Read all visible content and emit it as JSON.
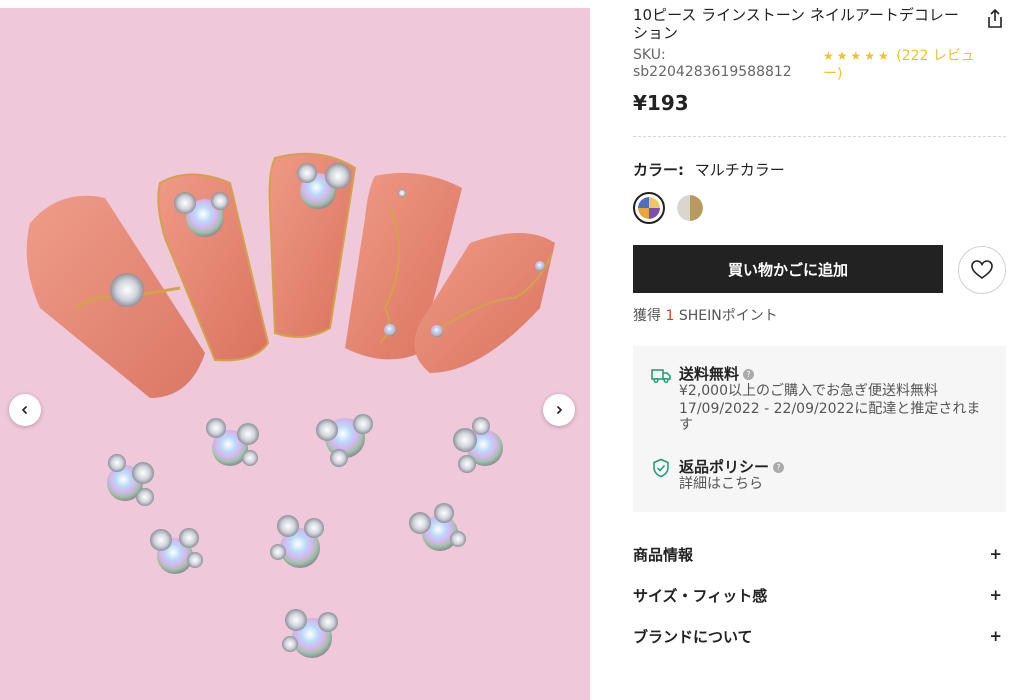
{
  "product": {
    "title": "10ピース ラインストーン ネイルアートデコレーション",
    "sku_label": "SKU:",
    "sku_value": "sb2204283619588812",
    "rating_stars": "★★★★★",
    "review_text": "(222 レビュー)",
    "price": "¥193"
  },
  "color": {
    "label": "カラー:",
    "value": "マルチカラー",
    "swatches": [
      "multicolor",
      "gold-silver"
    ]
  },
  "actions": {
    "add_to_cart": "買い物かごに追加"
  },
  "points": {
    "prefix": "獲得",
    "count": "1",
    "suffix": "SHEINポイント"
  },
  "shipping": {
    "free_title": "送料無料",
    "free_line1": "¥2,000以上のご購入でお急ぎ便送料無料",
    "free_line2": "17/09/2022 - 22/09/2022に配達と推定されます",
    "return_title": "返品ポリシー",
    "return_line": "詳細はこちら"
  },
  "accordions": [
    {
      "label": "商品情報",
      "icon": "+"
    },
    {
      "label": "サイズ・フィット感",
      "icon": "+"
    },
    {
      "label": "ブランドについて",
      "icon": "+"
    }
  ],
  "colors": {
    "cart_button": "#222222",
    "rating": "#f2c12e",
    "point_number": "#c44a1c",
    "image_bg": "#efc8da"
  }
}
